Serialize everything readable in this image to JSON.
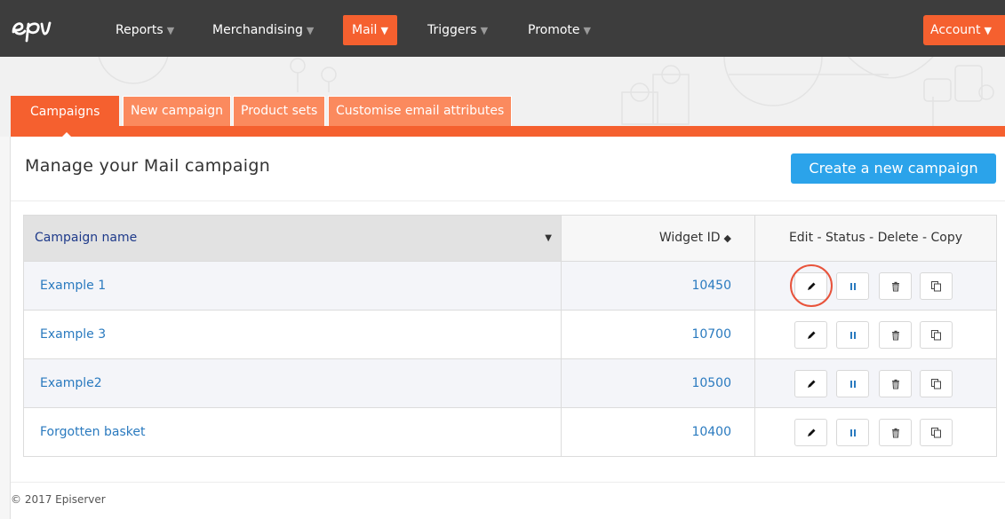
{
  "nav": {
    "logo_alt": "epi",
    "items": [
      {
        "label": "Reports"
      },
      {
        "label": "Merchandising"
      },
      {
        "label": "Mail"
      },
      {
        "label": "Triggers"
      },
      {
        "label": "Promote"
      }
    ],
    "account_label": "Account",
    "active_item": "Mail",
    "accent_color": "#f5602f",
    "bar_color": "#3d3d3d"
  },
  "tabs": [
    {
      "label": "Campaigns"
    },
    {
      "label": "New campaign"
    },
    {
      "label": "Product sets"
    },
    {
      "label": "Customise email attributes"
    }
  ],
  "active_tab": "Campaigns",
  "page": {
    "title": "Manage your Mail campaign",
    "create_button": "Create a new campaign",
    "button_color": "#2ba3ea"
  },
  "table": {
    "columns": {
      "name": "Campaign name",
      "widget": "Widget ID",
      "actions": "Edit - Status - Delete - Copy"
    },
    "rows": [
      {
        "name": "Example 1",
        "widget_id": "10450"
      },
      {
        "name": "Example 3",
        "widget_id": "10700"
      },
      {
        "name": "Example2",
        "widget_id": "10500"
      },
      {
        "name": "Forgotten basket",
        "widget_id": "10400"
      }
    ],
    "row_actions": [
      "pencil-icon",
      "pause-icon",
      "trash-icon",
      "copy-icon"
    ],
    "highlighted_row": "Example 1",
    "highlighted_action": "edit"
  },
  "footer": {
    "copyright": "© 2017 Episerver"
  }
}
